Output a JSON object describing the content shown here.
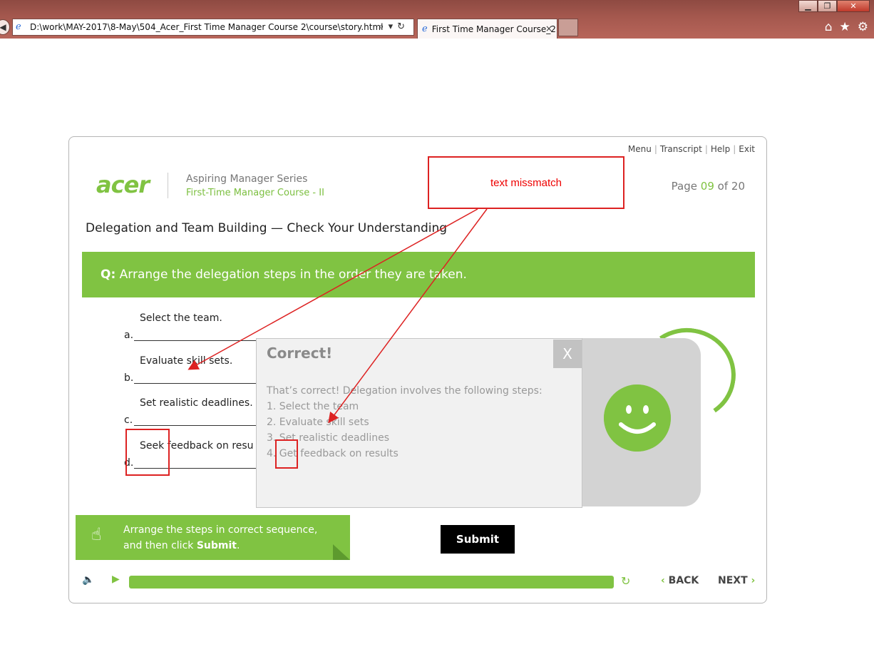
{
  "browser": {
    "address": "D:\\work\\MAY-2017\\8-May\\504_Acer_First Time Manager Course 2\\course\\story.html",
    "tab_title": "First Time Manager Course_2",
    "tab_close": "×",
    "win_min": "▁",
    "win_max": "❐",
    "win_close": "✕"
  },
  "header": {
    "menu": "Menu",
    "transcript": "Transcript",
    "help": "Help",
    "exit": "Exit",
    "logo": "acer",
    "series": "Aspiring Manager Series",
    "course": "First-Time Manager Course - II",
    "page_prefix": "Page",
    "page_current": "09",
    "page_of": "of",
    "page_total": "20"
  },
  "screen_title": "Delegation and Team Building — Check Your Understanding",
  "question": {
    "prefix": "Q:",
    "text": "Arrange the delegation steps in the order they are taken."
  },
  "answers": [
    {
      "label": "a.",
      "text": "Select the team."
    },
    {
      "label": "b.",
      "text": "Evaluate skill sets."
    },
    {
      "label": "c.",
      "text": "Set realistic deadlines."
    },
    {
      "label": "d.",
      "text": "Seek feedback on resu"
    }
  ],
  "feedback": {
    "close": "X",
    "title": "Correct!",
    "intro": "That’s correct! Delegation involves the following steps:",
    "steps": [
      "1. Select the team",
      "2. Evaluate skill sets",
      "3. Set realistic deadlines",
      "4. Get feedback on results"
    ]
  },
  "instruction": {
    "line1": "Arrange the steps in correct sequence,",
    "line2_pre": "and then click ",
    "line2_bold": "Submit",
    "line2_post": "."
  },
  "submit_label": "Submit",
  "player": {
    "back": "BACK",
    "next": "NEXT",
    "progress": 1.0
  },
  "annotation": {
    "text": "text missmatch",
    "color": "#dd2222"
  },
  "colors": {
    "accent": "#80c342"
  }
}
